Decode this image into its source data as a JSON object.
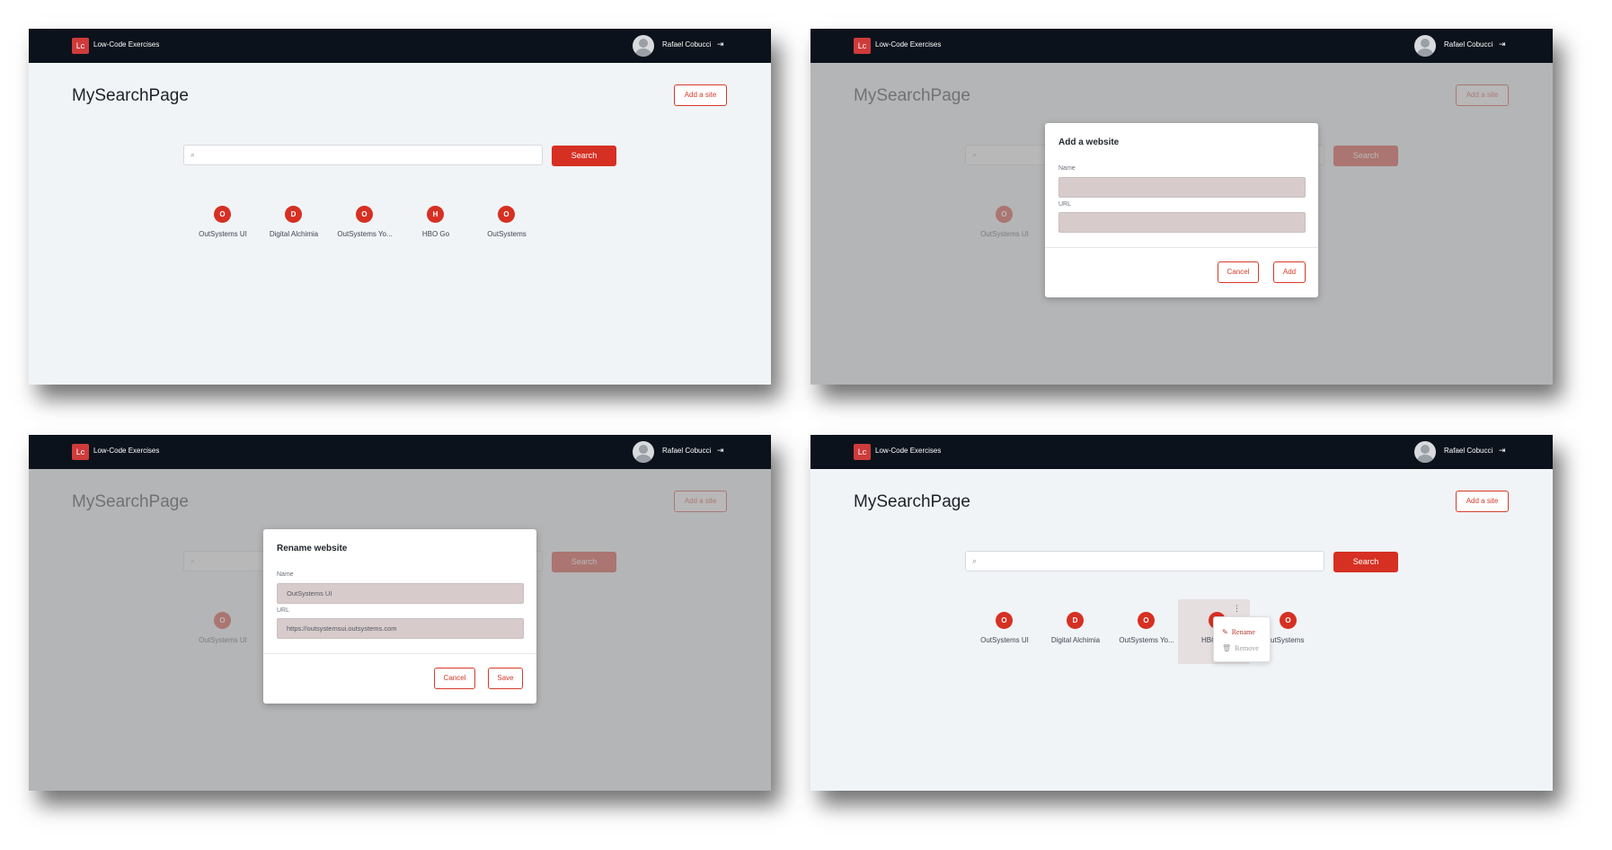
{
  "header": {
    "logo_text": "Lc",
    "app_name": "Low-Code Exercises",
    "user_name": "Rafael Cobucci",
    "logout_icon": "logout-icon"
  },
  "page": {
    "title": "MySearchPage",
    "add_site_label": "Add a site",
    "search_button_label": "Search",
    "search_placeholder": ""
  },
  "sites": [
    {
      "initial": "O",
      "label": "OutSystems UI"
    },
    {
      "initial": "D",
      "label": "Digital Alchimia"
    },
    {
      "initial": "O",
      "label": "OutSystems Yo..."
    },
    {
      "initial": "H",
      "label": "HBO Go"
    },
    {
      "initial": "O",
      "label": "OutSystems"
    }
  ],
  "add_modal": {
    "title": "Add a website",
    "name_label": "Name",
    "url_label": "URL",
    "name_value": "",
    "url_value": "",
    "cancel_label": "Cancel",
    "confirm_label": "Add"
  },
  "rename_modal": {
    "title": "Rename website",
    "name_label": "Name",
    "url_label": "URL",
    "name_value": "OutSystems UI",
    "url_value": "https://outsystemsui.outsystems.com",
    "cancel_label": "Cancel",
    "confirm_label": "Save"
  },
  "context_menu": {
    "rename_label": "Rename",
    "remove_label": "Remove",
    "hbo_partial_label": "HBO",
    "outsystems_partial_label": "utSystems"
  },
  "colors": {
    "header_bg": "#0b121b",
    "accent": "#d63023",
    "page_bg": "#f1f4f7",
    "field_bg": "#d7cbcc"
  }
}
